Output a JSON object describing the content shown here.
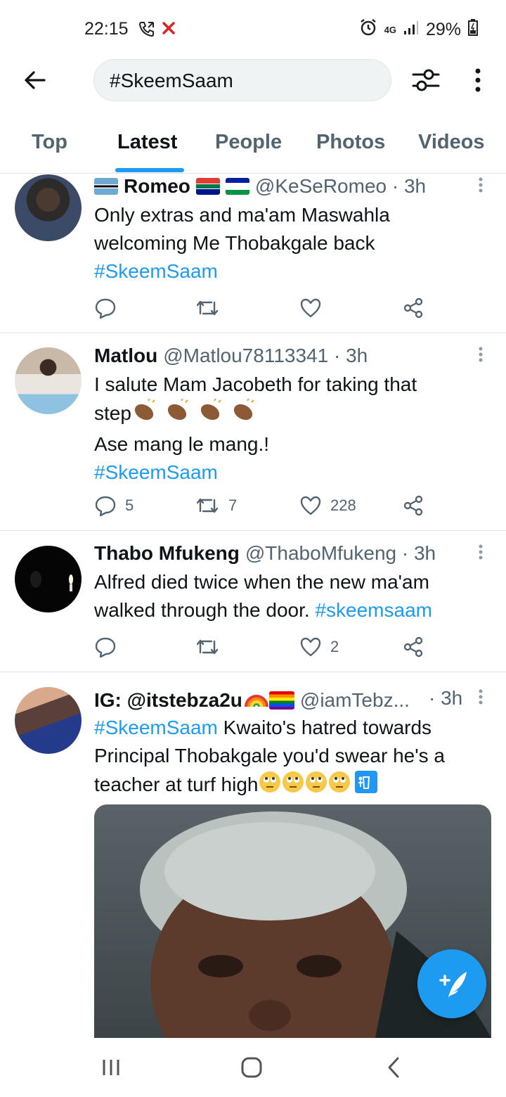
{
  "status_bar": {
    "time": "22:15",
    "network": "4G",
    "battery": "29%"
  },
  "search": {
    "query": "#SkeemSaam"
  },
  "tabs": [
    {
      "label": "Top"
    },
    {
      "label": "Latest",
      "active": true
    },
    {
      "label": "People"
    },
    {
      "label": "Photos"
    },
    {
      "label": "Videos"
    }
  ],
  "tweets": [
    {
      "name": "Romeo",
      "handle": "@KeSeRomeo · 3h",
      "text_lines": [
        "Only extras and ma'am Maswahla",
        "welcoming Me Thobakgale back"
      ],
      "hashtag": "#SkeemSaam",
      "replies": "",
      "retweets": "",
      "likes": ""
    },
    {
      "name": "Matlou",
      "handle": "@Matlou78113341 · 3h",
      "text_line1": "I salute Mam Jacobeth for taking that",
      "text_line2": "step",
      "text_line3": "Ase mang le mang.!",
      "hashtag": "#SkeemSaam",
      "replies": "5",
      "retweets": "7",
      "likes": "228"
    },
    {
      "name": "Thabo Mfukeng",
      "handle": "@ThaboMfukeng · 3h",
      "text_line1": "Alfred died twice when the new ma'am",
      "text_line2": "walked through the door.",
      "hashtag": "#skeemsaam",
      "replies": "",
      "retweets": "",
      "likes": "2"
    },
    {
      "name": "IG: @itstebza2u",
      "handle": "@iamTebz...",
      "time": "· 3h",
      "hashtag": "#SkeemSaam",
      "text_line1": " Kwaito's hatred towards",
      "text_line2": "Principal Thobakgale you'd swear he's a",
      "text_line3": "teacher at turf high"
    }
  ],
  "colors": {
    "accent": "#1d9bf0",
    "text": "#0f1419",
    "muted": "#536471",
    "divider": "#dfe4e6"
  }
}
